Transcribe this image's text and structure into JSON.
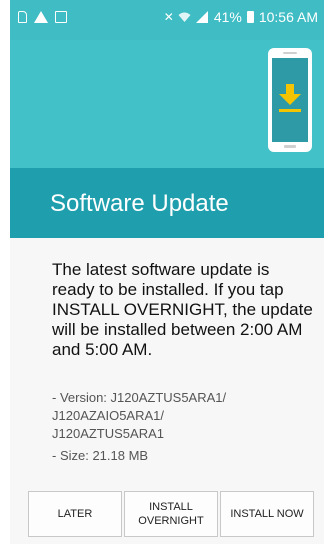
{
  "status_bar": {
    "battery": "41%",
    "time": "10:56 AM"
  },
  "header": {
    "title": "Software Update"
  },
  "body": {
    "message": "The latest software update is ready to be installed. If you tap INSTALL OVERNIGHT, the update will be installed between 2:00 AM and 5:00 AM.",
    "version_line1": "- Version: J120AZTUS5ARA1/",
    "version_line2": "J120AZAIO5ARA1/",
    "version_line3": "J120AZTUS5ARA1",
    "size": "- Size: 21.18 MB"
  },
  "buttons": {
    "later": "LATER",
    "install_overnight": "INSTALL\nOVERNIGHT",
    "install_now": "INSTALL NOW"
  },
  "colors": {
    "banner": "#43c1c9",
    "title_band": "#1f9fad",
    "accent_icon": "#f5c400"
  }
}
